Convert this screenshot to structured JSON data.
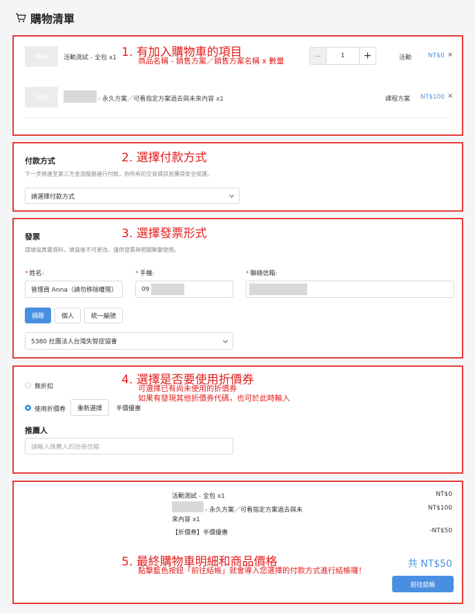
{
  "header": {
    "title": "購物清單",
    "icon": "cart-icon"
  },
  "cart": {
    "annotation": "1. 有加入購物車的項目",
    "annotation_sub": "商品名稱 - 銷售方案／銷售方案名稱 x 數量",
    "items": [
      {
        "thumb": "IMG",
        "name": "活動測試 - 全包 x1",
        "quantity": "1",
        "type": "活動",
        "price": "NT$0"
      },
      {
        "thumb": "IMG",
        "name": "- 永久方案／可看指定方案過去與未來內容 x1",
        "type": "課程方案",
        "price": "NT$100"
      }
    ],
    "minus": "—",
    "plus": "+",
    "remove": "×"
  },
  "payment": {
    "annotation": "2. 選擇付款方式",
    "title": "付款方式",
    "desc": "下一步將連至第三方金流服務進行付款，你所有的交易資訊皆獲得安全保護。",
    "select_placeholder": "請選擇付款方式"
  },
  "invoice": {
    "annotation": "3. 選擇發票形式",
    "title": "發票",
    "desc": "請填寫真實資料，填寫後不可更改，僅供發票與相關聯繫使用。",
    "name_label": "姓名:",
    "phone_label": "手機:",
    "email_label": "聯絡信箱:",
    "name_value": "管理員 Anna（請勿移除權限）",
    "phone_value": "09",
    "tabs": [
      "捐贈",
      "個人",
      "統一編號"
    ],
    "donation_org": "5380 社團法人台灣失智症協會"
  },
  "coupon": {
    "annotation": "4. 選擇是否要使用折價券",
    "annotation_sub1": "可選擇已有尚未使用的折價券",
    "annotation_sub2": "如果有發現其他折價券代碼，也可於此時輸入",
    "no_discount": "無折扣",
    "use_coupon": "使用折價券",
    "reselect": "重新選擇",
    "coupon_name": "半價優惠",
    "referrer_title": "推薦人",
    "referrer_placeholder": "請輸入推薦人的註冊信箱"
  },
  "summary": {
    "annotation": "5. 最終購物車明細和商品價格",
    "annotation_sub": "點擊藍色按鈕「前往結帳」就會導入您選擇的付款方式進行結帳囉！",
    "rows": [
      {
        "label": "活動測試 - 全包 x1",
        "price": "NT$0"
      },
      {
        "label": "- 永久方案／可看指定方案過去與未",
        "label2": "來內容 x1",
        "price": "NT$100"
      },
      {
        "label": "【折價券】半價優惠",
        "price": "-NT$50"
      }
    ],
    "total": "共 NT$50",
    "checkout": "前往結帳"
  },
  "colors": {
    "accent": "#4a90e2",
    "annotation": "#e31b1b"
  }
}
